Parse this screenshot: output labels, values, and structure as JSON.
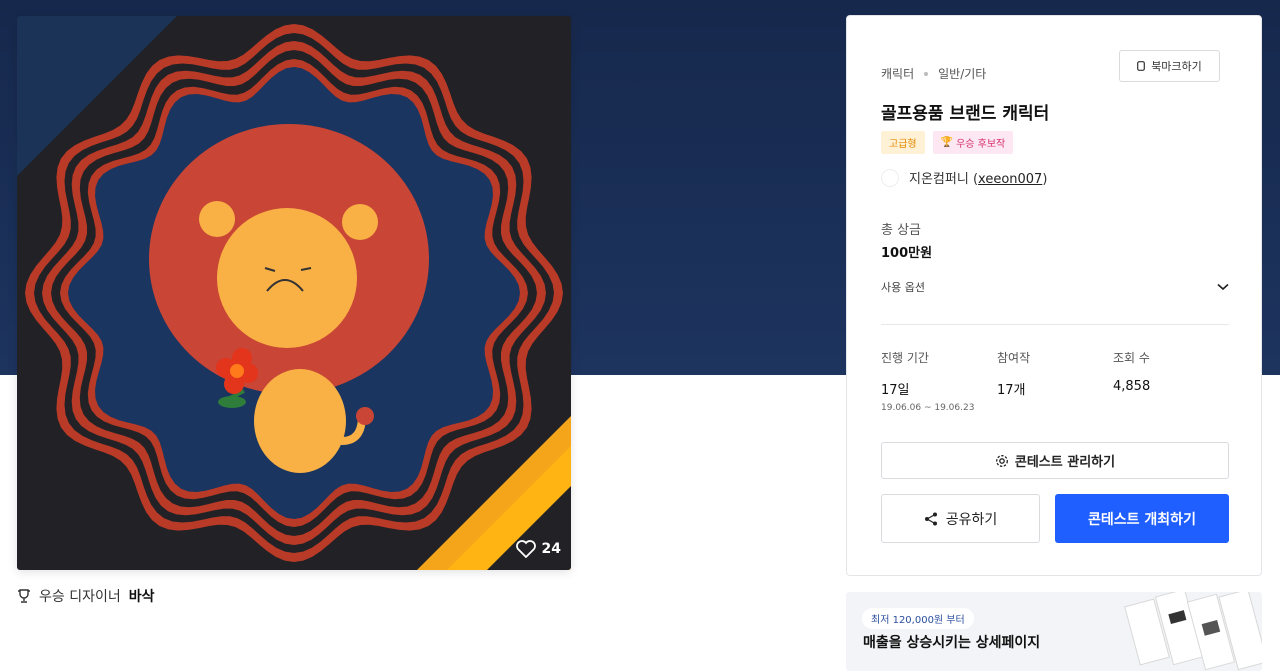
{
  "artwork": {
    "likes": "24"
  },
  "award_line": {
    "prefix": "우승 디자이너",
    "designer": "바삭"
  },
  "panel": {
    "category": "캐릭터",
    "subcategory": "일반/기타",
    "bookmark_label": "북마크하기",
    "title": "골프용품 브랜드 캐릭터",
    "badges": {
      "grade": "고급형",
      "winner": "우승 후보작"
    },
    "owner": {
      "company": "지온컴퍼니",
      "username": "xeeon007"
    },
    "prize": {
      "label": "총 상금",
      "value": "100만원"
    },
    "usage_label": "사용 옵션",
    "stats": {
      "duration": {
        "label": "진행 기간",
        "value": "17일",
        "range": "19.06.06 ~ 19.06.23"
      },
      "entries": {
        "label": "참여작",
        "value": "17개"
      },
      "views": {
        "label": "조회 수",
        "value": "4,858"
      }
    },
    "manage_button": "콘테스트 관리하기",
    "share_button": "공유하기",
    "host_button": "콘테스트 개최하기"
  },
  "ad": {
    "pill": "최저 120,000원 부터",
    "headline": "매출을 상승시키는 상세페이지"
  },
  "colors": {
    "hero": "#16284c",
    "primary": "#1f5eff",
    "lion_mane": "#c94535",
    "lion_face": "#f9b146"
  }
}
